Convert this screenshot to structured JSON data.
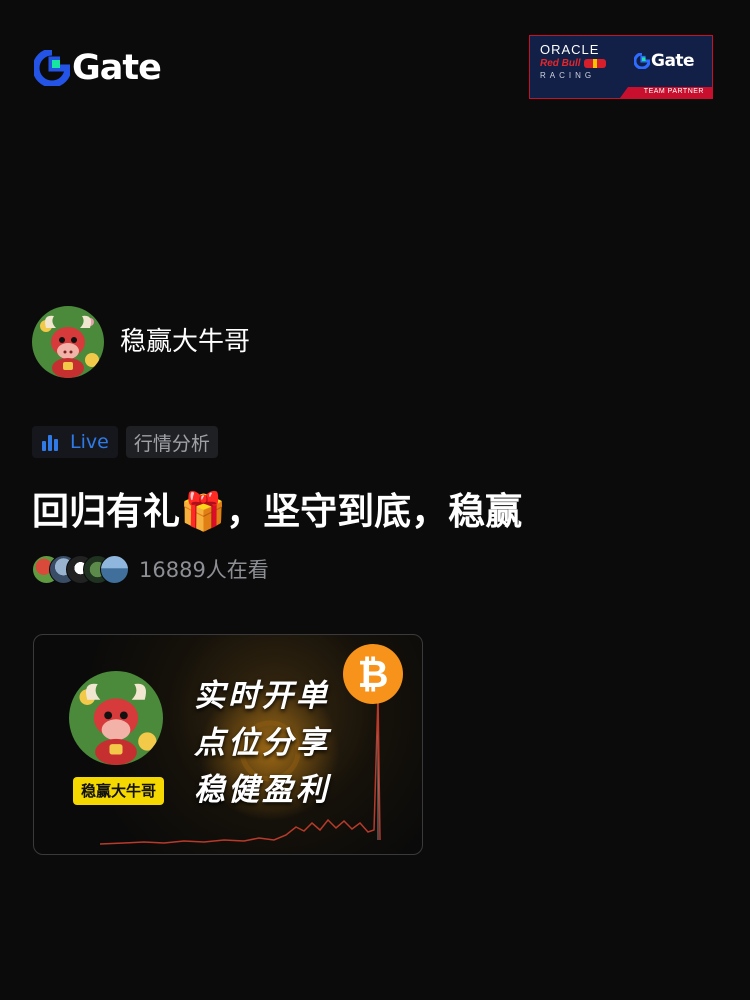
{
  "brand": {
    "logo_text": "Gate",
    "accent": "#2354e6",
    "accent_green": "#17e6a1"
  },
  "partner": {
    "oracle": "ORACLE",
    "redbull": "Red Bull",
    "racing": "RACING",
    "gate": "Gate",
    "strip": "TEAM PARTNER"
  },
  "host": {
    "name": "稳赢大牛哥",
    "avatar_icon": "bull-avatar-icon"
  },
  "tags": {
    "live": "Live",
    "category": "行情分析",
    "live_color": "#2f7ae6"
  },
  "stream": {
    "title": "回归有礼🎁，坚守到底，稳赢",
    "viewer_count": "16889人在看"
  },
  "thumbnail": {
    "host_label": "稳赢大牛哥",
    "lines": [
      "实时开单",
      "点位分享",
      "稳健盈利"
    ],
    "badge": "₿"
  }
}
